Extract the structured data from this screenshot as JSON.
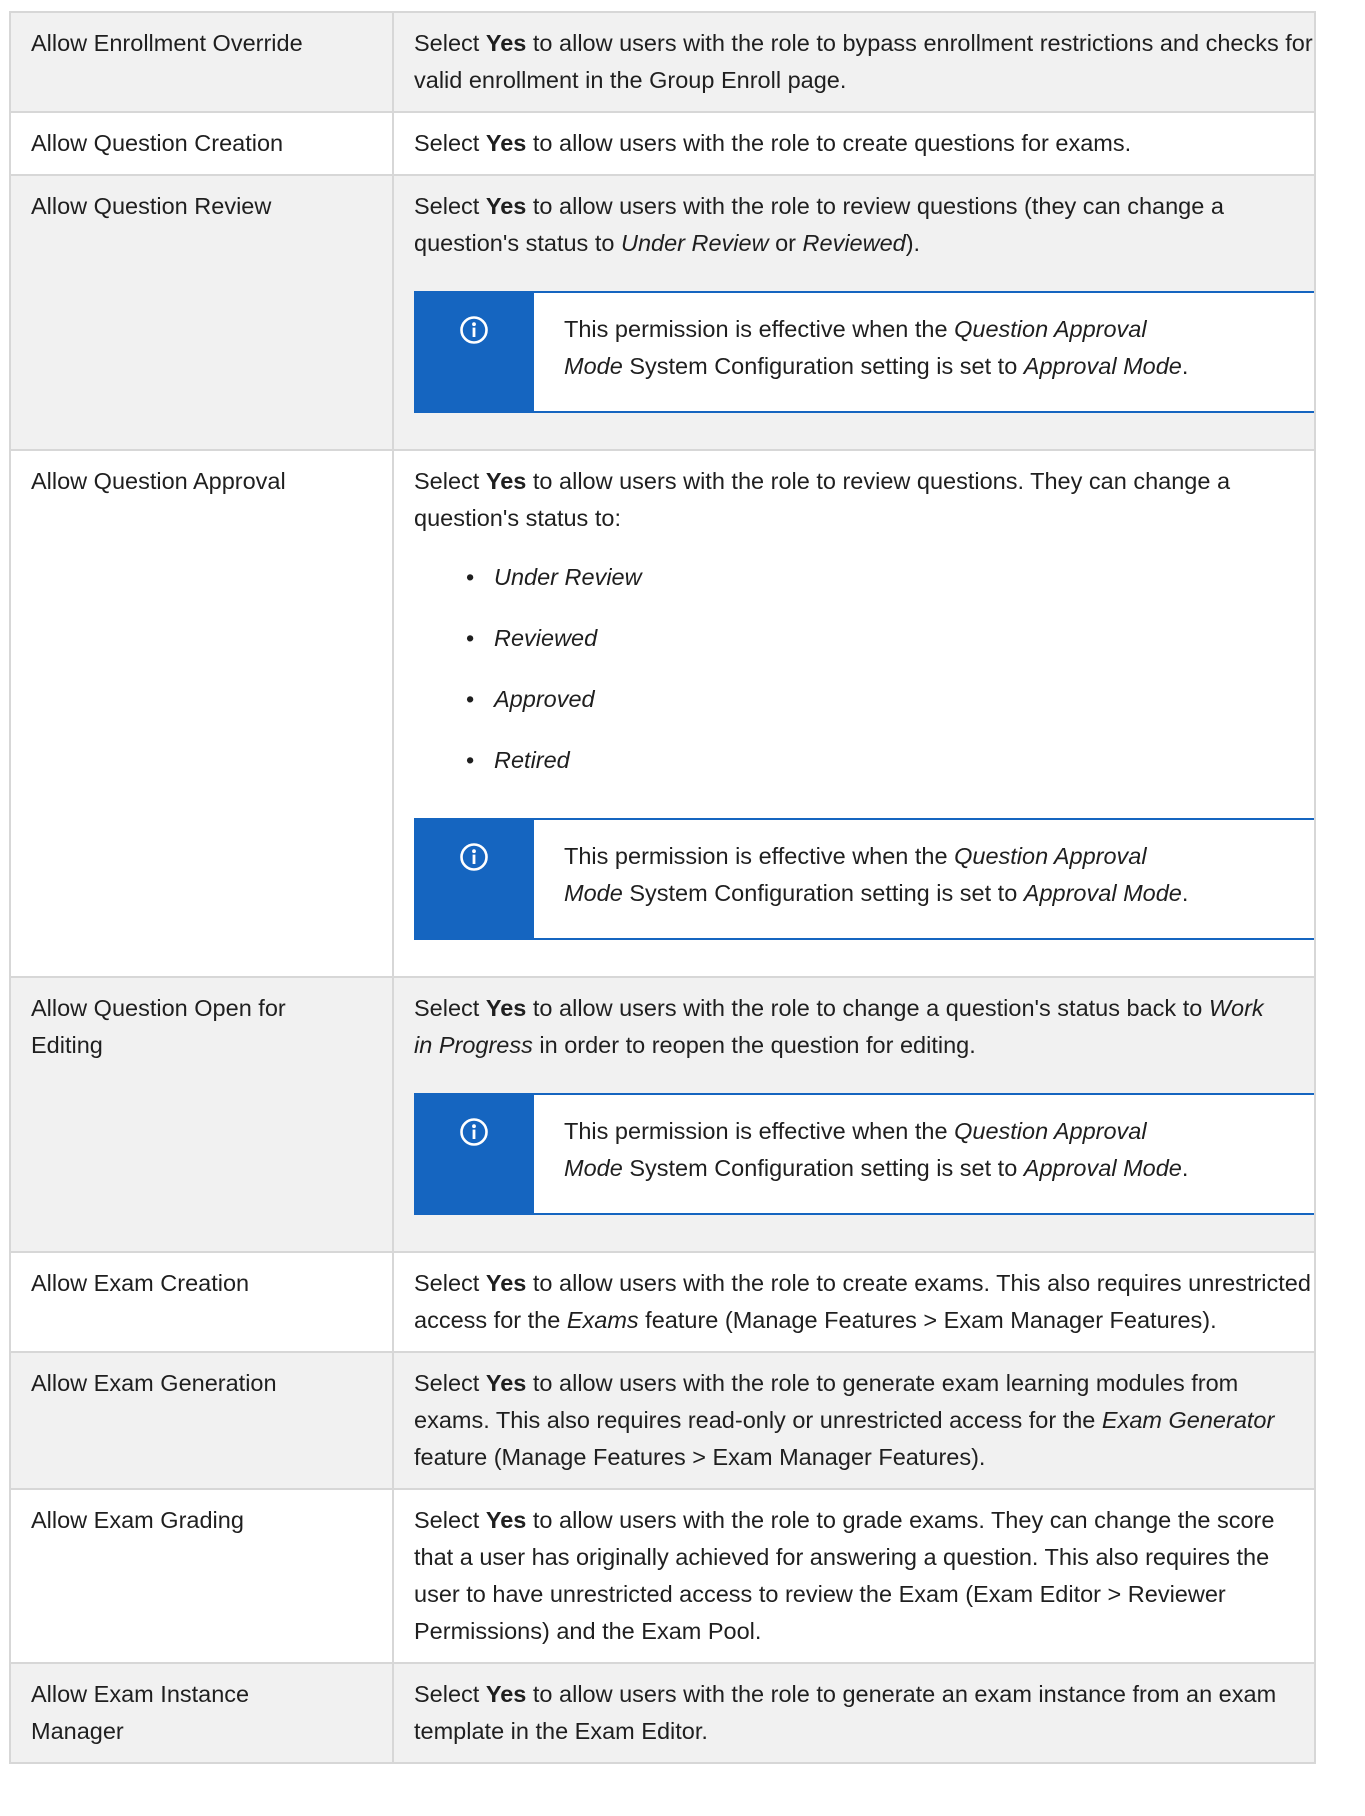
{
  "rows": [
    {
      "name": "Allow Enrollment Override",
      "pre": "Select ",
      "bold": "Yes",
      "post": " to allow users with the role to bypass enrollment restrictions and checks for valid enrollment in the Group Enroll page."
    },
    {
      "name": "Allow Question Creation",
      "pre": "Select ",
      "bold": "Yes",
      "post": " to allow users with the role to create questions for exams."
    },
    {
      "name": "Allow Question Review",
      "pre": "Select ",
      "bold": "Yes",
      "post": " to allow users with the role to review questions (they can change a question's status to ",
      "em1": "Under Review",
      "mid": " or ",
      "em2": "Reviewed",
      "end": ")."
    },
    {
      "name": "Allow Question Approval",
      "pre": "Select ",
      "bold": "Yes",
      "post": " to allow users with the role to review questions. They can change a question's status to:",
      "bullet": "•",
      "list": [
        "Under Review",
        "Reviewed",
        "Approved",
        "Retired"
      ]
    },
    {
      "name1": "Allow Question Open for",
      "name2": "Editing",
      "pre": "Select ",
      "bold": "Yes",
      "post": " to allow users with the role to change a question's status back to ",
      "em1": "Work",
      "em2": "in Progress",
      "end": " in order to reopen the question for editing."
    },
    {
      "name": "Allow Exam Creation",
      "pre": "Select ",
      "bold": "Yes",
      "post": " to allow users with the role to create exams. This also requires unrestricted access for the ",
      "em1": "Exams",
      "end": " feature (Manage Features > Exam Manager Features)."
    },
    {
      "name": "Allow Exam Generation",
      "pre": "Select ",
      "bold": "Yes",
      "post": " to allow users with the role to generate exam learning modules from exams. This also requires read-only or unrestricted access for the ",
      "em1": "Exam Generator",
      "end": " feature (Manage Features > Exam Manager Features)."
    },
    {
      "name": "Allow Exam Grading",
      "pre": "Select ",
      "bold": "Yes",
      "post": " to allow users with the role to grade exams. They can change the score that a user has originally achieved for answering a question. This also requires the user to have unrestricted access to review the Exam (Exam Editor > Reviewer Permissions) and the Exam Pool."
    },
    {
      "name1": "Allow Exam Instance",
      "name2": "Manager",
      "pre": "Select ",
      "bold": "Yes",
      "post": " to allow users with the role to generate an exam instance from an exam template in the Exam Editor."
    }
  ],
  "note": {
    "icon": "info-circle-icon",
    "pre": "This permission is effective when the ",
    "em1": "Question Approval",
    "em1b": "Mode",
    "mid": " System Configuration setting is set to ",
    "em2": "Approval Mode",
    "end": "."
  },
  "colors": {
    "accent": "#1565c0",
    "shade": "#f1f1f1",
    "border": "#d7d7d7"
  }
}
